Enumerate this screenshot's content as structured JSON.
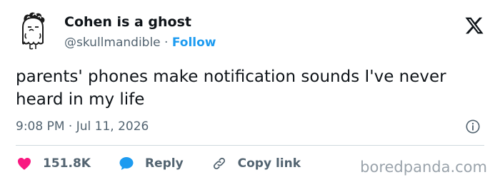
{
  "tweet": {
    "author": {
      "display_name": "Cohen is a ghost",
      "handle": "@skullmandible",
      "separator": "·",
      "follow_label": "Follow",
      "avatar_icon": "ghost-avatar-icon"
    },
    "text": "parents' phones make notification sounds I've never heard in my life",
    "timestamp": "9:08 PM · Jul 11, 2026",
    "actions": {
      "like_count": "151.8K",
      "reply_label": "Reply",
      "copy_link_label": "Copy link"
    }
  },
  "icons": {
    "platform": "x-logo-icon",
    "info": "info-icon",
    "like": "heart-icon",
    "reply": "speech-bubble-icon",
    "copy_link": "link-icon"
  },
  "colors": {
    "text_primary": "#0f1419",
    "text_secondary": "#536471",
    "accent": "#1d9bf0",
    "like": "#f91880",
    "divider": "#cfd9de"
  },
  "watermark": "boredpanda.com"
}
